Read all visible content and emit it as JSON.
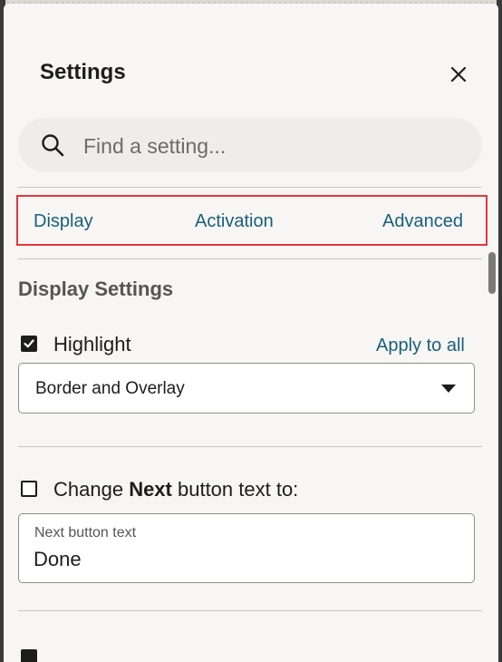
{
  "dialog": {
    "title": "Settings",
    "close_icon": "close-icon"
  },
  "search": {
    "placeholder": "Find a setting...",
    "icon": "search-icon"
  },
  "tabs": [
    {
      "label": "Display"
    },
    {
      "label": "Activation"
    },
    {
      "label": "Advanced"
    }
  ],
  "display_settings": {
    "section_title": "Display Settings",
    "highlight": {
      "label": "Highlight",
      "checked": true,
      "apply_all_label": "Apply to all",
      "selected_option": "Border and Overlay"
    },
    "next_button": {
      "label_prefix": "Change ",
      "label_bold": "Next",
      "label_suffix": " button text to:",
      "checked": false,
      "field_label": "Next button text",
      "field_value": "Done"
    },
    "clipped_checkbox_checked": true
  },
  "colors": {
    "accent_link": "#17607d",
    "highlight_box": "#e3363d",
    "panel_bg": "#f8f6f4"
  }
}
